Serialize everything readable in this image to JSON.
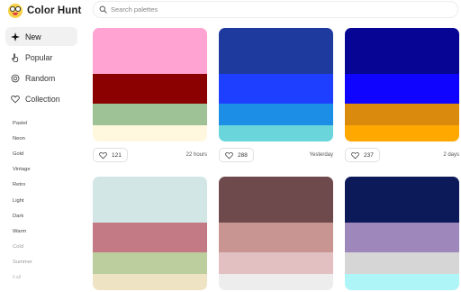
{
  "app": {
    "name": "Color Hunt",
    "logo_icon": "smiley-face-logo-icon"
  },
  "search": {
    "placeholder": "Search palettes",
    "value": "",
    "icon": "search-icon"
  },
  "sidebar": {
    "nav": [
      {
        "label": "New",
        "icon": "sparkle-icon",
        "active": true
      },
      {
        "label": "Popular",
        "icon": "hand-pointer-icon",
        "active": false
      },
      {
        "label": "Random",
        "icon": "random-icon",
        "active": false
      },
      {
        "label": "Collection",
        "icon": "heart-icon",
        "active": false
      }
    ],
    "tags": [
      "Pastel",
      "Neon",
      "Gold",
      "Vintage",
      "Retro",
      "Light",
      "Dark",
      "Warm",
      "Cold",
      "Summer",
      "Fall"
    ]
  },
  "palettes": [
    {
      "colors": [
        "#FFA4D2",
        "#8B0000",
        "#9EC296",
        "#FFF8DE"
      ],
      "likes": "121",
      "time": "22 hours"
    },
    {
      "colors": [
        "#1F3A9E",
        "#1E3FFF",
        "#1C8EE6",
        "#6AD6DC"
      ],
      "likes": "288",
      "time": "Yesterday"
    },
    {
      "colors": [
        "#070593",
        "#0F05FF",
        "#DA8A0C",
        "#FFA800"
      ],
      "likes": "237",
      "time": "2 days"
    },
    {
      "colors": [
        "#D1E6E5",
        "#C47A84",
        "#BCCE9E",
        "#EEE4C3"
      ],
      "likes": "",
      "time": ""
    },
    {
      "colors": [
        "#6E4A4C",
        "#C89593",
        "#E2BFC1",
        "#EDEDED"
      ],
      "likes": "",
      "time": ""
    },
    {
      "colors": [
        "#0D1A5A",
        "#9E87BA",
        "#D6D6D6",
        "#AEF5F7"
      ],
      "likes": "",
      "time": ""
    }
  ]
}
